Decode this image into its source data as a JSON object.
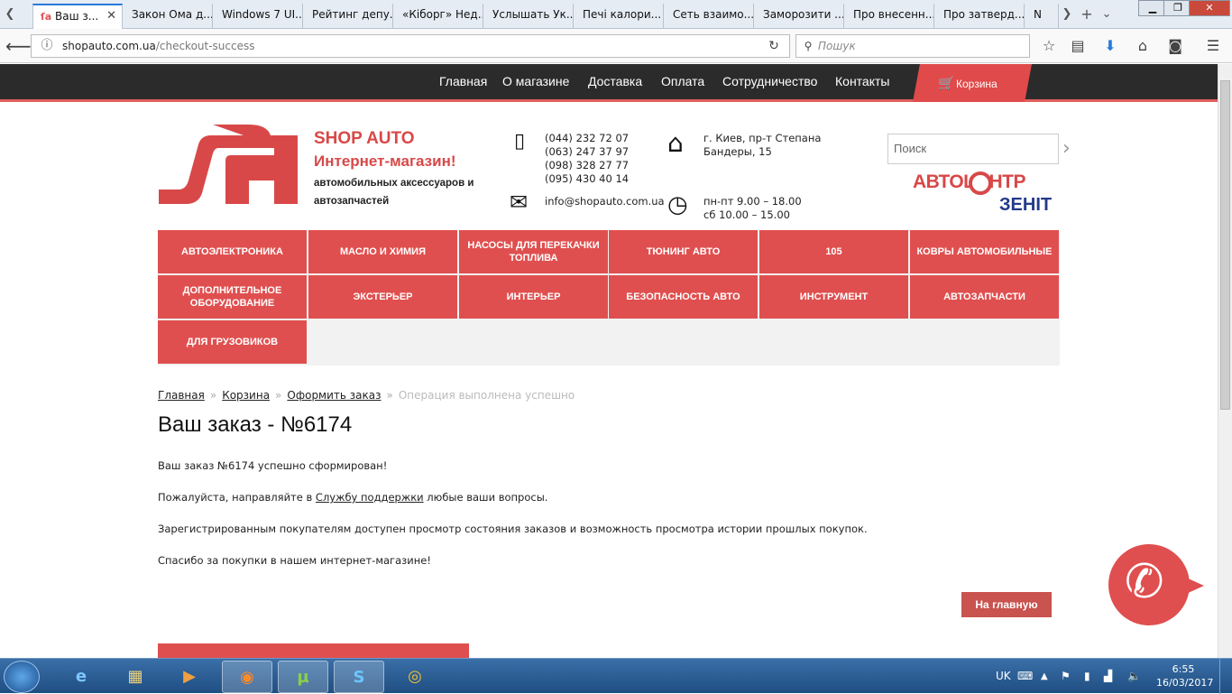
{
  "browser": {
    "tabs": [
      {
        "label": "Ваш з...",
        "active": true
      },
      {
        "label": "Закон Ома д..."
      },
      {
        "label": "Windows 7 UI..."
      },
      {
        "label": "Рейтинг депу..."
      },
      {
        "label": "«Кіборг» Нед..."
      },
      {
        "label": "Услышать Ук..."
      },
      {
        "label": "Печі калори..."
      },
      {
        "label": "Сеть взаимо..."
      },
      {
        "label": "Заморозити ..."
      },
      {
        "label": "Про внесенн..."
      },
      {
        "label": "Про затверд..."
      },
      {
        "label": "N"
      }
    ],
    "url_host": "shopauto.com.ua",
    "url_path": "/checkout-success",
    "search_placeholder": "Пошук",
    "icons": [
      "info-icon",
      "reload-icon",
      "search-icon",
      "bookmark-star-icon",
      "reader-icon",
      "download-icon",
      "home-icon",
      "pocket-icon",
      "menu-icon"
    ]
  },
  "site": {
    "nav": [
      "Главная",
      "О магазине",
      "Доставка",
      "Оплата",
      "Сотрудничество",
      "Контакты"
    ],
    "cart_label": "Корзина",
    "brand_title": "SHOP AUTO",
    "brand_subtitle": "Интернет-магазин!",
    "brand_description": "автомобильных аксессуаров и автозапчастей",
    "phones": [
      "(044) 232 72 07",
      "(063) 247 37 97",
      "(098) 328 27 77",
      "(095) 430 40 14"
    ],
    "email": "info@shopauto.com.ua",
    "address": [
      "г. Киев, пр-т Степана",
      "Бандеры, 15"
    ],
    "hours": [
      "пн-пт 9.00 – 18.00",
      "сб 10.00 – 15.00"
    ],
    "search_placeholder": "Поиск",
    "partner_line1": "АВТОЦЕНТР",
    "partner_line2": "ЗЕНІТ",
    "categories": [
      "Автоэлектроника",
      "Масло и химия",
      "Насосы для перекачки топлива",
      "Тюнинг авто",
      "105",
      "Ковры автомобильные",
      "Дополнительное оборудование",
      "Экстерьер",
      "Интерьер",
      "Безопасность авто",
      "Инструмент",
      "Автозапчасти",
      "Для грузовиков"
    ],
    "accent_color": "#e04f4f"
  },
  "breadcrumb": {
    "items": [
      "Главная",
      "Корзина",
      "Оформить заказ"
    ],
    "current": "Операция выполнена успешно"
  },
  "content": {
    "title": "Ваш заказ - №6174",
    "p1": "Ваш заказ №6174 успешно сформирован!",
    "p2_before": "Пожалуйста, направляйте в ",
    "p2_link": "Службу поддержки",
    "p2_after": " любые ваши вопросы.",
    "p3": "Зарегистрированным покупателям доступен просмотр состояния заказов и возможность просмотра истории прошлых покупок.",
    "p4": "Спасибо за покупки в нашем интернет-магазине!",
    "home_button": "На главную"
  },
  "taskbar": {
    "apps": [
      "internet-explorer",
      "file-explorer",
      "media-player",
      "firefox",
      "utorrent",
      "skype",
      "chrome"
    ],
    "lang": "UK",
    "time": "6:55",
    "date": "16/03/2017"
  }
}
